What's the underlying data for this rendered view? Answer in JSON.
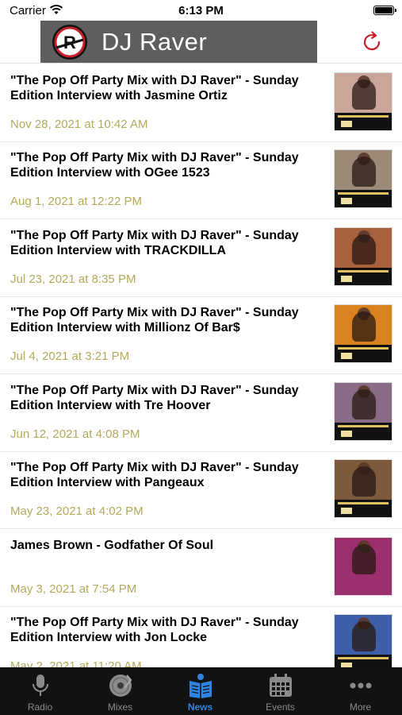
{
  "status_bar": {
    "carrier": "Carrier",
    "time": "6:13 PM"
  },
  "header": {
    "title": "DJ Raver",
    "logo_letter": "R"
  },
  "colors": {
    "brand_bar": "#5e5e5e",
    "date_text": "#b4aa5a",
    "refresh": "#c8202a",
    "tab_active": "#2f84e0",
    "tab_inactive": "#8a8a8a"
  },
  "feed": [
    {
      "title": "\"The Pop Off Party Mix with DJ Raver\" - Sunday Edition Interview with Jasmine Ortiz",
      "date": "Nov 28, 2021 at 10:42 AM",
      "thumb": "#c9a59a"
    },
    {
      "title": "\"The Pop Off Party Mix with DJ Raver\" - Sunday Edition Interview with OGee 1523",
      "date": "Aug 1, 2021 at 12:22 PM",
      "thumb": "#9b8a78"
    },
    {
      "title": "\"The Pop Off Party Mix with DJ Raver\" - Sunday Edition Interview with TRACKDILLA",
      "date": "Jul 23, 2021 at 8:35 PM",
      "thumb": "#a8613c"
    },
    {
      "title": "\"The Pop Off Party Mix with DJ Raver\" - Sunday Edition Interview with Millionz Of Bar$",
      "date": "Jul 4, 2021 at 3:21 PM",
      "thumb": "#d9821f"
    },
    {
      "title": "\"The Pop Off Party Mix with DJ Raver\" - Sunday Edition Interview with Tre Hoover",
      "date": "Jun 12, 2021 at 4:08 PM",
      "thumb": "#8a6b86"
    },
    {
      "title": "\"The Pop Off Party Mix with DJ Raver\" - Sunday Edition Interview with Pangeaux",
      "date": "May 23, 2021 at 4:02 PM",
      "thumb": "#7d5a3c"
    },
    {
      "title": "James Brown - Godfather Of Soul",
      "date": "May 3, 2021 at 7:54 PM",
      "thumb": "#9c2f6e"
    },
    {
      "title": "\"The Pop Off Party Mix with DJ Raver\" - Sunday Edition Interview with Jon Locke",
      "date": "May 2, 2021 at 11:20 AM",
      "thumb": "#3c5fa8"
    }
  ],
  "tabs": [
    {
      "label": "Radio",
      "icon": "microphone-icon",
      "active": false
    },
    {
      "label": "Mixes",
      "icon": "vinyl-record-icon",
      "active": false
    },
    {
      "label": "News",
      "icon": "newspaper-reader-icon",
      "active": true
    },
    {
      "label": "Events",
      "icon": "calendar-icon",
      "active": false
    },
    {
      "label": "More",
      "icon": "more-dots-icon",
      "active": false
    }
  ]
}
